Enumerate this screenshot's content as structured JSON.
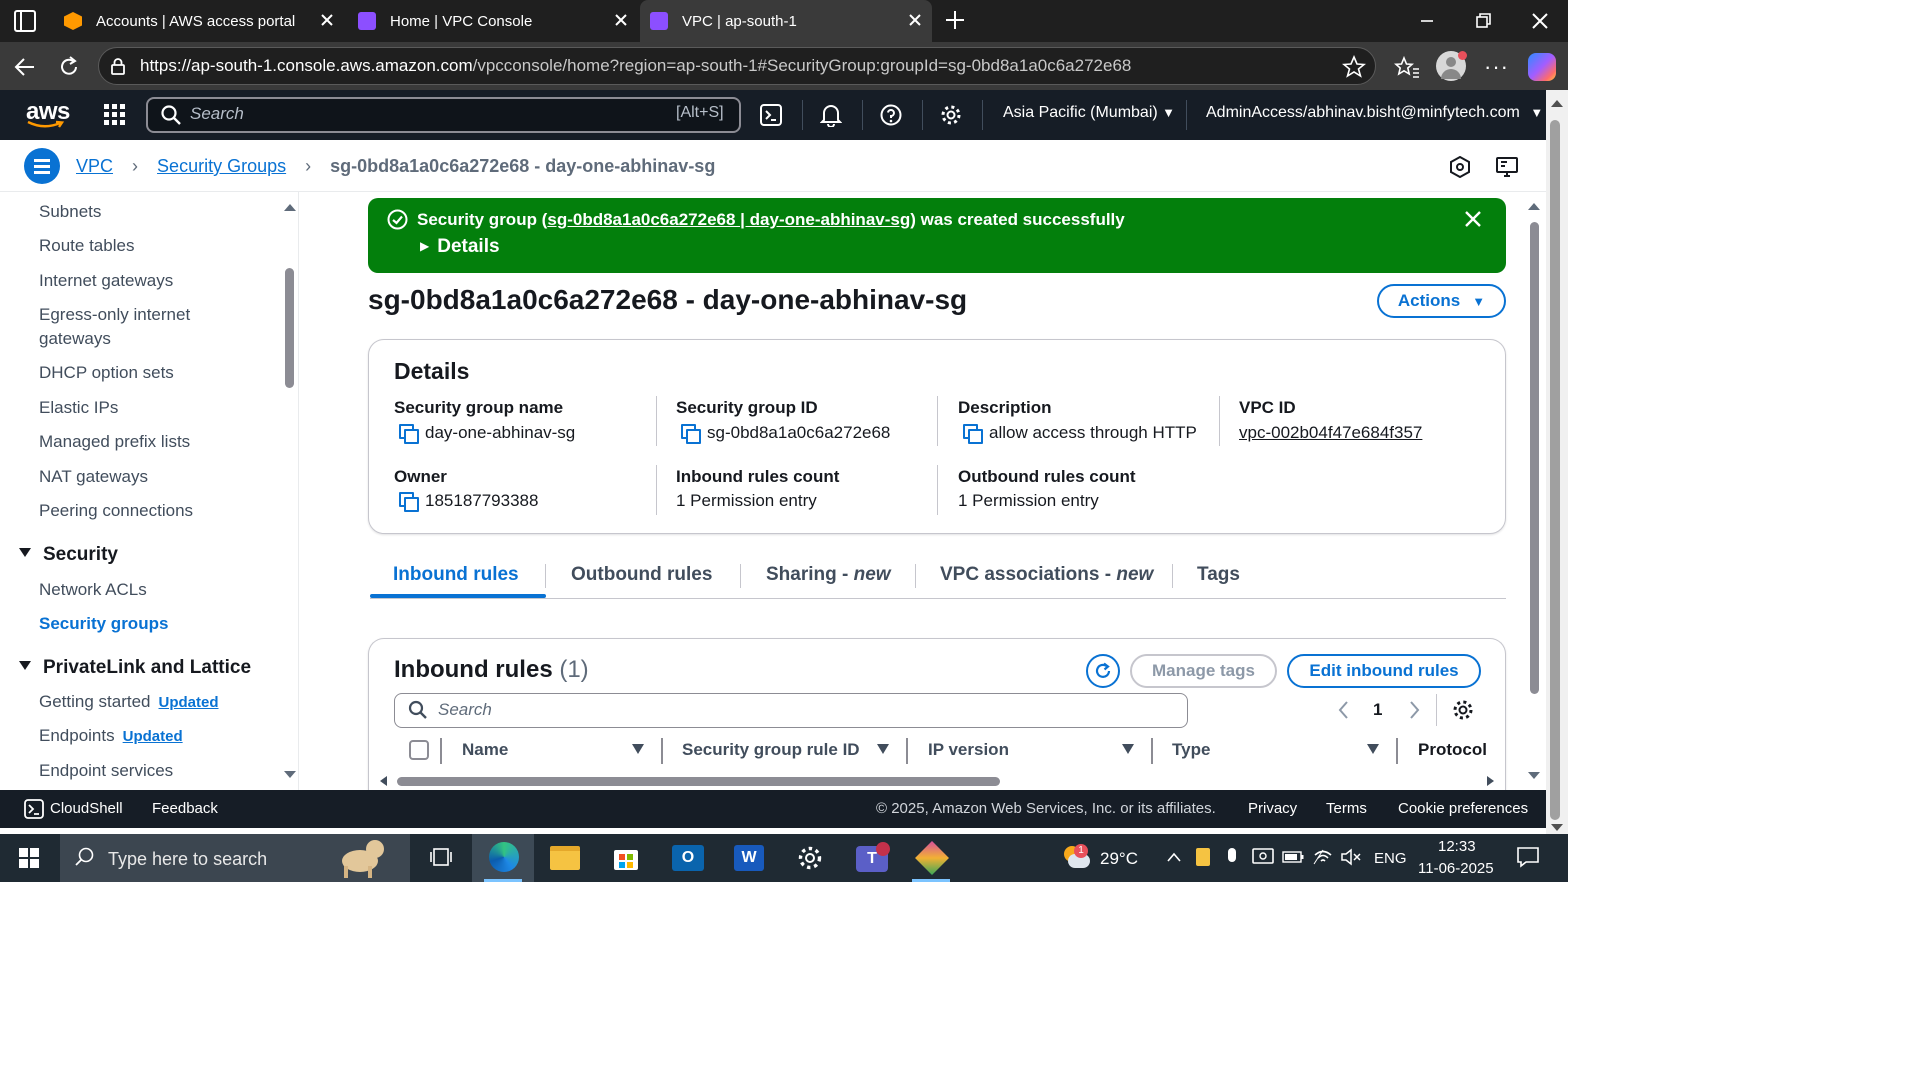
{
  "browser": {
    "tabs": [
      {
        "title": "Accounts | AWS access portal"
      },
      {
        "title": "Home | VPC Console"
      },
      {
        "title": "VPC | ap-south-1"
      }
    ],
    "url_host": "https://ap-south-1.console.aws.amazon.com",
    "url_path": "/vpcconsole/home?region=ap-south-1#SecurityGroup:groupId=sg-0bd8a1a0c6a272e68"
  },
  "aws_header": {
    "logo": "aws",
    "search_placeholder": "Search",
    "search_shortcut": "[Alt+S]",
    "region": "Asia Pacific (Mumbai)",
    "account": "AdminAccess/abhinav.bisht@minfytech.com"
  },
  "breadcrumb": {
    "items": [
      "VPC",
      "Security Groups",
      "sg-0bd8a1a0c6a272e68 - day-one-abhinav-sg"
    ]
  },
  "sidebar": {
    "items": [
      "Subnets",
      "Route tables",
      "Internet gateways",
      "Egress-only internet",
      "gateways",
      "DHCP option sets",
      "Elastic IPs",
      "Managed prefix lists",
      "NAT gateways",
      "Peering connections"
    ],
    "security_header": "Security",
    "security_items": [
      "Network ACLs",
      "Security groups"
    ],
    "privatelink_header": "PrivateLink and Lattice",
    "privatelink_items": [
      "Getting started",
      "Endpoints",
      "Endpoint services"
    ],
    "updated_badge": "Updated"
  },
  "flash": {
    "prefix": "Security group (",
    "link": "sg-0bd8a1a0c6a272e68 | day-one-abhinav-sg",
    "suffix": ") was created successfully",
    "details": "Details",
    "color": "#037f0c"
  },
  "page": {
    "title": "sg-0bd8a1a0c6a272e68 - day-one-abhinav-sg",
    "actions": "Actions"
  },
  "details": {
    "heading": "Details",
    "fields": {
      "sg_name_label": "Security group name",
      "sg_name": "day-one-abhinav-sg",
      "sg_id_label": "Security group ID",
      "sg_id": "sg-0bd8a1a0c6a272e68",
      "desc_label": "Description",
      "desc": "allow access through HTTP",
      "vpc_label": "VPC ID",
      "vpc": "vpc-002b04f47e684f357",
      "owner_label": "Owner",
      "owner": "185187793388",
      "inbound_label": "Inbound rules count",
      "inbound": "1 Permission entry",
      "outbound_label": "Outbound rules count",
      "outbound": "1 Permission entry"
    }
  },
  "tabs": {
    "inbound": "Inbound rules",
    "outbound": "Outbound rules",
    "sharing": "Sharing - ",
    "vpc_assoc": "VPC associations - ",
    "new_tag": "new",
    "tags": "Tags"
  },
  "inbound_panel": {
    "title": "Inbound rules",
    "count": "(1)",
    "manage_tags": "Manage tags",
    "edit": "Edit inbound rules",
    "search_placeholder": "Search",
    "page": "1",
    "columns": [
      "Name",
      "Security group rule ID",
      "IP version",
      "Type",
      "Protocol"
    ]
  },
  "footer": {
    "cloudshell": "CloudShell",
    "feedback": "Feedback",
    "copyright": "© 2025, Amazon Web Services, Inc. or its affiliates.",
    "privacy": "Privacy",
    "terms": "Terms",
    "cookies": "Cookie preferences"
  },
  "taskbar": {
    "search_placeholder": "Type here to search",
    "weather": "29°C",
    "lang": "ENG",
    "time": "12:33",
    "date": "11-06-2025",
    "badge": "1"
  },
  "colors": {
    "accent": "#0972d3",
    "header": "#161d26",
    "success": "#037f0c"
  }
}
